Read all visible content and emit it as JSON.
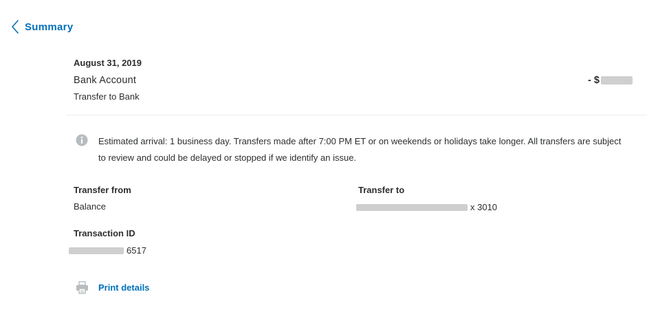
{
  "header": {
    "back_label": "Summary"
  },
  "transaction": {
    "date": "August 31, 2019",
    "account_name": "Bank Account",
    "type": "Transfer to Bank",
    "amount_prefix": "- $"
  },
  "notice": {
    "text": "Estimated arrival: 1 business day. Transfers made after 7:00 PM ET or on weekends or holidays take longer. All transfers are subject to review and could be delayed or stopped if we identify an issue."
  },
  "details": {
    "from_label": "Transfer from",
    "from_value": "Balance",
    "to_label": "Transfer to",
    "to_value_suffix": "x 3010",
    "txid_label": "Transaction ID",
    "txid_suffix": "6517"
  },
  "actions": {
    "print_label": "Print details"
  },
  "icons": {
    "back": "chevron-left-icon",
    "info": "info-icon",
    "print": "printer-icon"
  },
  "colors": {
    "link": "#0070ba",
    "text": "#2c2e2f",
    "icon_gray": "#b7bcbf",
    "redaction": "#cfcfcf"
  }
}
